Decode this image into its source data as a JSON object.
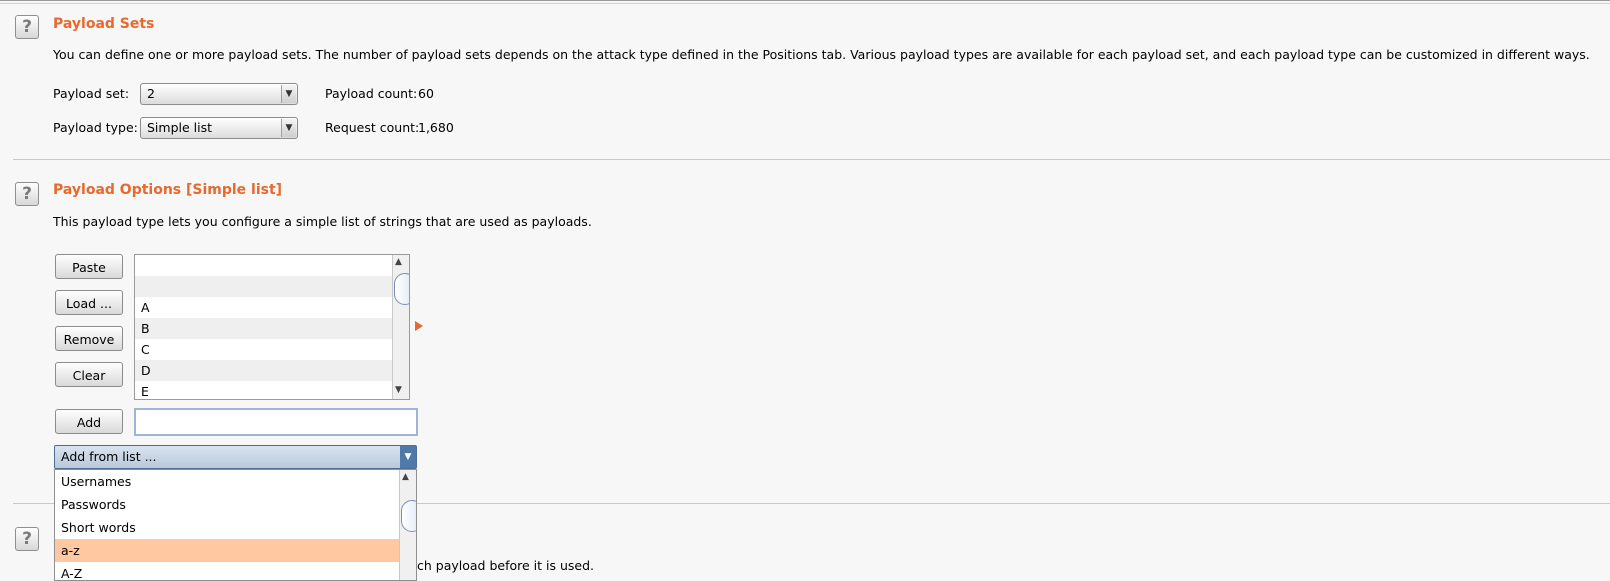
{
  "payload_sets": {
    "title": "Payload Sets",
    "description": "You can define one or more payload sets. The number of payload sets depends on the attack type defined in the Positions tab. Various payload types are available for each payload set, and each payload type can be customized in different ways.",
    "set_label": "Payload set:",
    "set_value": "2",
    "type_label": "Payload type:",
    "type_value": "Simple list",
    "count_label": "Payload count:",
    "count_value": "60",
    "request_label": "Request count:",
    "request_value": "1,680"
  },
  "payload_options": {
    "title": "Payload Options [Simple list]",
    "description": "This payload type lets you configure a simple list of strings that are used as payloads.",
    "buttons": {
      "paste": "Paste",
      "load": "Load ...",
      "remove": "Remove",
      "clear": "Clear",
      "add": "Add"
    },
    "list_items": [
      "",
      "",
      "A",
      "B",
      "C",
      "D",
      "E"
    ],
    "add_value": "",
    "add_from_list": "Add from list ...",
    "dropdown_options": [
      "Usernames",
      "Passwords",
      "Short words",
      "a-z",
      "A-Z"
    ],
    "selected_option": "a-z"
  },
  "third_section": {
    "description_fragment": "ch payload before it is used."
  },
  "icons": {
    "help": "help-icon",
    "arrow": "chevron-down-icon"
  },
  "colors": {
    "heading": "#e8692e",
    "selection": "#ffc8a0"
  }
}
